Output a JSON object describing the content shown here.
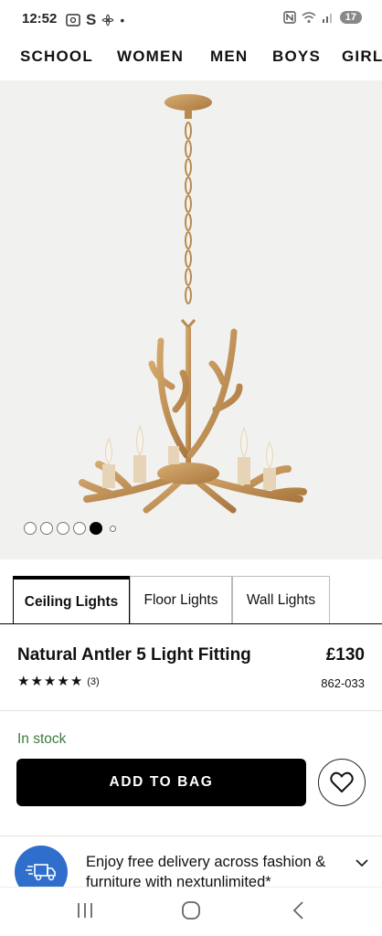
{
  "status_bar": {
    "time": "12:52",
    "left_icons": [
      "screenshot-icon",
      "S",
      "fan-icon",
      "•"
    ],
    "battery": "17"
  },
  "categories": [
    "SCHOOL",
    "WOMEN",
    "MEN",
    "BOYS",
    "GIRL"
  ],
  "gallery": {
    "dot_count": 6,
    "active_index": 4
  },
  "tabs": [
    {
      "label": "Ceiling Lights",
      "active": true
    },
    {
      "label": "Floor Lights",
      "active": false
    },
    {
      "label": "Wall Lights",
      "active": false
    }
  ],
  "product": {
    "title": "Natural Antler 5 Light Fitting",
    "price": "£130",
    "rating_stars": 5,
    "review_count": "(3)",
    "code": "862-033",
    "stock": "In stock"
  },
  "actions": {
    "add_to_bag": "ADD TO BAG",
    "favourite_icon": "heart-icon"
  },
  "delivery": {
    "text": "Enjoy free delivery across fashion & furniture with nextunlimited*",
    "icon": "delivery-truck-icon"
  },
  "colors": {
    "stock_green": "#3c7a3c",
    "delivery_blue": "#2f6fcb",
    "image_bg": "#f1f1ef"
  }
}
